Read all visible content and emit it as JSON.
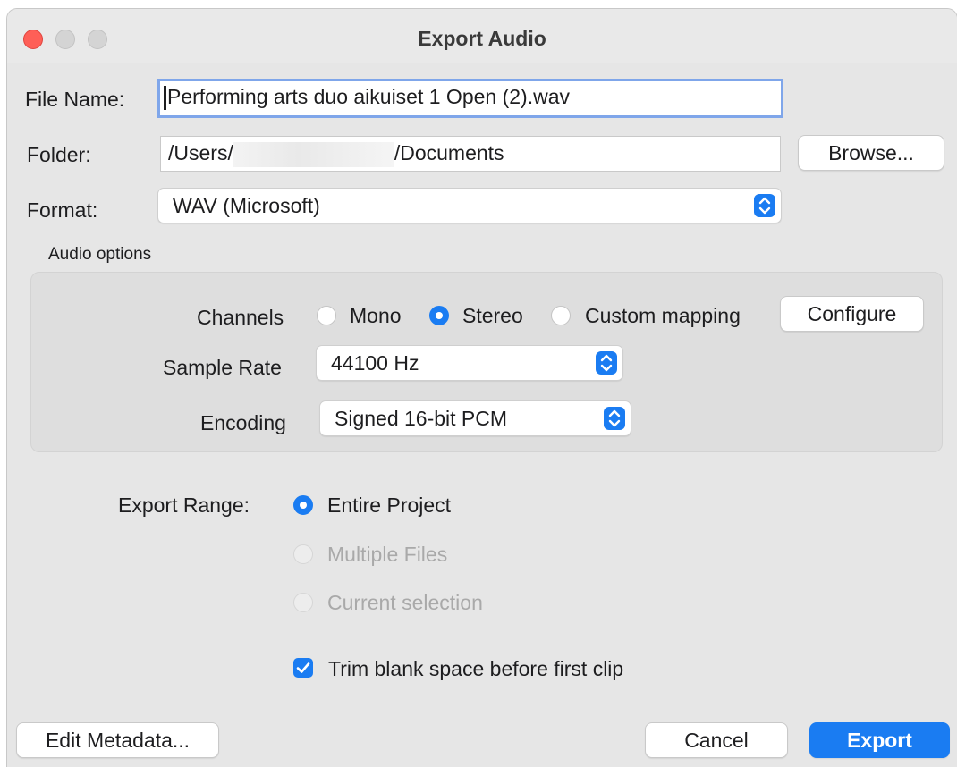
{
  "window": {
    "title": "Export Audio"
  },
  "file_name": {
    "label": "File Name:",
    "value": "Performing arts duo aikuiset 1 Open (2).wav"
  },
  "folder": {
    "label": "Folder:",
    "value_prefix": "/Users/",
    "value_suffix": "/Documents",
    "browse_label": "Browse..."
  },
  "format": {
    "label": "Format:",
    "selected": "WAV (Microsoft)"
  },
  "audio_options": {
    "heading": "Audio options",
    "channels": {
      "label": "Channels",
      "options": [
        "Mono",
        "Stereo",
        "Custom mapping"
      ],
      "selected": "Stereo",
      "configure_label": "Configure"
    },
    "sample_rate": {
      "label": "Sample Rate",
      "selected": "44100 Hz"
    },
    "encoding": {
      "label": "Encoding",
      "selected": "Signed 16-bit PCM"
    }
  },
  "export_range": {
    "label": "Export Range:",
    "options": [
      "Entire Project",
      "Multiple Files",
      "Current selection"
    ],
    "selected": "Entire Project"
  },
  "trim": {
    "label": "Trim blank space before first clip",
    "checked": true
  },
  "footer": {
    "edit_metadata_label": "Edit Metadata...",
    "cancel_label": "Cancel",
    "export_label": "Export"
  },
  "colors": {
    "accent": "#1a7cf2",
    "close": "#fe5f57",
    "window_bg": "#e6e6e6"
  }
}
